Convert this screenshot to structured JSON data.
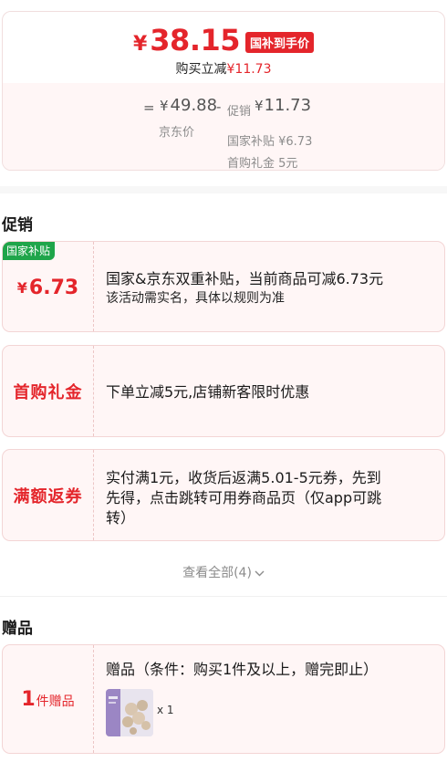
{
  "price": {
    "currency": "¥",
    "final": "38.15",
    "badge": "国补到手价",
    "instant_label": "购买立减",
    "instant_amount": "¥11.73"
  },
  "breakdown": {
    "eq": "=",
    "jd_price": "49.88",
    "jd_label": "京东价",
    "minus": "-",
    "promo_label": "促销",
    "promo_amount": "11.73",
    "lines": [
      "国家补贴 ¥6.73",
      "首购礼金 5元"
    ]
  },
  "promotions": {
    "title": "促销",
    "items": [
      {
        "tag": "国家补贴",
        "left_currency": "¥",
        "left_value": "6.73",
        "text": "国家&京东双重补贴，当前商品可减6.73元",
        "subtext": "该活动需实名，具体以规则为准"
      },
      {
        "left_text": "首购礼金",
        "text": "下单立减5元,店铺新客限时优惠"
      },
      {
        "left_text": "满额返券",
        "text": "实付满1元，收货后返满5.01-5元券，先到先得，点击跳转可用券商品页（仅app可跳转）"
      }
    ],
    "view_all": "查看全部(4)"
  },
  "gifts": {
    "title": "赠品",
    "count": "1",
    "count_unit": "件赠品",
    "condition": "赠品（条件：购买1件及以上，赠完即止）",
    "qty": "x 1"
  },
  "colors": {
    "accent": "#e4252b",
    "tag_green": "#1fa54a",
    "card_bg": "#fff6f6"
  }
}
